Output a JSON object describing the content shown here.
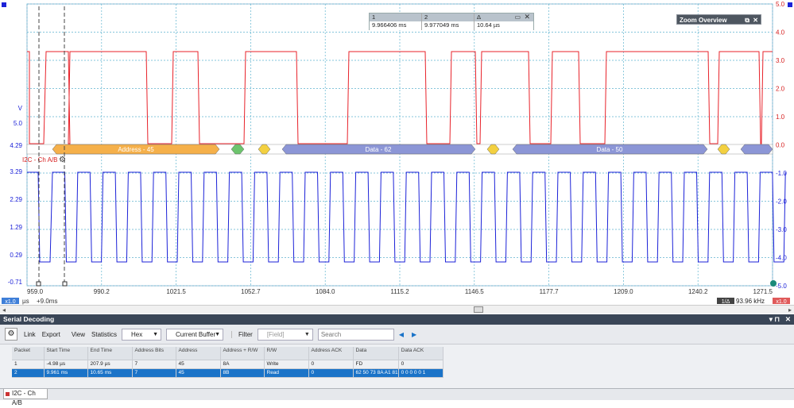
{
  "scope": {
    "left_axis_labels": [
      "V",
      "5.0",
      "4.29",
      "3.29",
      "2.29",
      "1.29",
      "0.29",
      "-0.71"
    ],
    "right_axis_labels": [
      "5.0",
      "4.0",
      "3.0",
      "2.0",
      "1.0",
      "0.0",
      "-1.0",
      "-2.0",
      "-3.0",
      "-4.0",
      "-5.0"
    ],
    "time_labels": [
      "959.0",
      "990.2",
      "1021.5",
      "1052.7",
      "1084.0",
      "1115.2",
      "1146.5",
      "1177.7",
      "1209.0",
      "1240.2",
      "1271.5"
    ],
    "time_unit": "µs",
    "time_offset": "+9.0ms",
    "scale_badge_left": "x1.0",
    "scale_badge_right": "x1.0",
    "freq_readout": "93.96 kHz",
    "freq_prefix": "1/Δ",
    "i2c_label": "I2C - Ch A/B",
    "channel_a_color": "#e8222a",
    "channel_b_color": "#1c22d8",
    "packets": [
      {
        "label": "Address - 45",
        "color": "#f5b04a"
      },
      {
        "label": "Data - 62",
        "color": "#8c96d6"
      },
      {
        "label": "Data - 50",
        "color": "#8c96d6"
      }
    ]
  },
  "rulers": {
    "headers": [
      "1",
      "2",
      "Δ"
    ],
    "values": [
      "9.966406 ms",
      "9.977049 ms",
      "10.64 µs"
    ]
  },
  "zoom_overview": {
    "title": "Zoom Overview"
  },
  "serial": {
    "title": "Serial Decoding",
    "toolbar": {
      "link": "Link",
      "export": "Export",
      "view": "View",
      "statistics": "Statistics",
      "format": "Hex",
      "buffer": "Current Buffer",
      "filter": "Filter",
      "field": "[Field]",
      "search_placeholder": "Search"
    },
    "columns": [
      "Packet",
      "Start Time",
      "End Time",
      "Address Bits",
      "Address",
      "Address + R/W",
      "R/W",
      "Address ACK",
      "Data",
      "Data ACK"
    ],
    "rows": [
      [
        "1",
        "-4.98 µs",
        "207.9 µs",
        "7",
        "45",
        "8A",
        "Write",
        "0",
        "FD",
        "0"
      ],
      [
        "2",
        "9.961 ms",
        "10.65 ms",
        "7",
        "45",
        "8B",
        "Read",
        "0",
        "62 50 73 8A A1 81",
        "0 0 0 0 0 1"
      ]
    ],
    "tab": "I2C - Ch A/B"
  }
}
